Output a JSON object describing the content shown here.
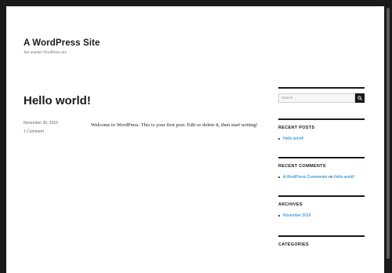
{
  "site": {
    "title": "A WordPress Site",
    "description": "Just another WordPress site"
  },
  "post": {
    "title": "Hello world!",
    "date": "November 30, 2016",
    "comments_link": "1 Comment",
    "content": "Welcome to WordPress. This is your first post. Edit or delete it, then start writing!"
  },
  "sidebar": {
    "search": {
      "placeholder": "Search …",
      "button_icon": "search-icon"
    },
    "recent_posts": {
      "title": "RECENT POSTS",
      "items": [
        "Hello world!"
      ]
    },
    "recent_comments": {
      "title": "RECENT COMMENTS",
      "items": [
        {
          "author": "A WordPress Commenter",
          "connector": "on",
          "post": "Hello world!"
        }
      ]
    },
    "archives": {
      "title": "ARCHIVES",
      "items": [
        "November 2016"
      ]
    },
    "categories": {
      "title": "CATEGORIES"
    }
  },
  "colors": {
    "link": "#007acc",
    "text": "#1a1a1a",
    "frame": "#1a1a1a",
    "meta": "#686868"
  }
}
